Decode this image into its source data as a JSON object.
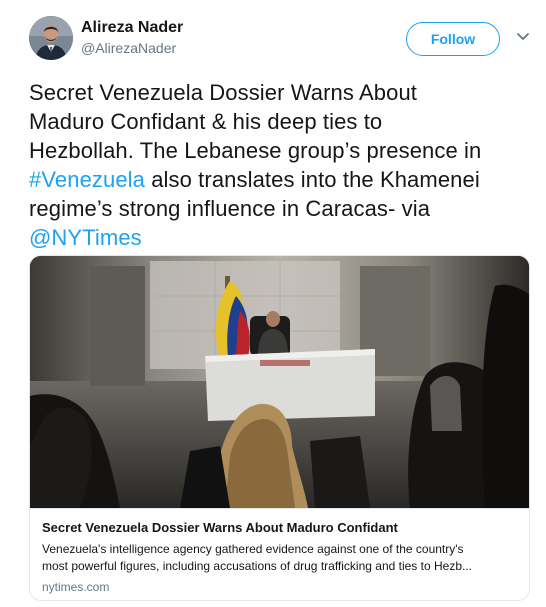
{
  "author": {
    "name": "Alireza Nader",
    "handle": "@AlirezaNader"
  },
  "follow_label": "Follow",
  "tweet": {
    "line1": "Secret Venezuela Dossier Warns About",
    "line2": "Maduro Confidant & his deep ties to",
    "line3_a": "Hezbollah. The Lebanese group’s presence in",
    "hashtag": "#Venezuela",
    "line4_b": " also translates into the Khamenei",
    "line5": "regime’s strong influence in Caracas-    via",
    "mention": "@NYTimes"
  },
  "card": {
    "title": "Secret Venezuela Dossier Warns About Maduro Confidant",
    "description_line1": "Venezuela's intelligence agency gathered evidence against one of the country's",
    "description_line2": "most powerful figures, including accusations of drug trafficking and ties to Hezb...",
    "domain": "nytimes.com"
  },
  "icons": {
    "avatar": "author-avatar",
    "menu": "chevron-down-icon"
  },
  "colors": {
    "link": "#1da1f2",
    "text": "#14171a",
    "secondary": "#657786",
    "border": "#e1e8ed"
  }
}
